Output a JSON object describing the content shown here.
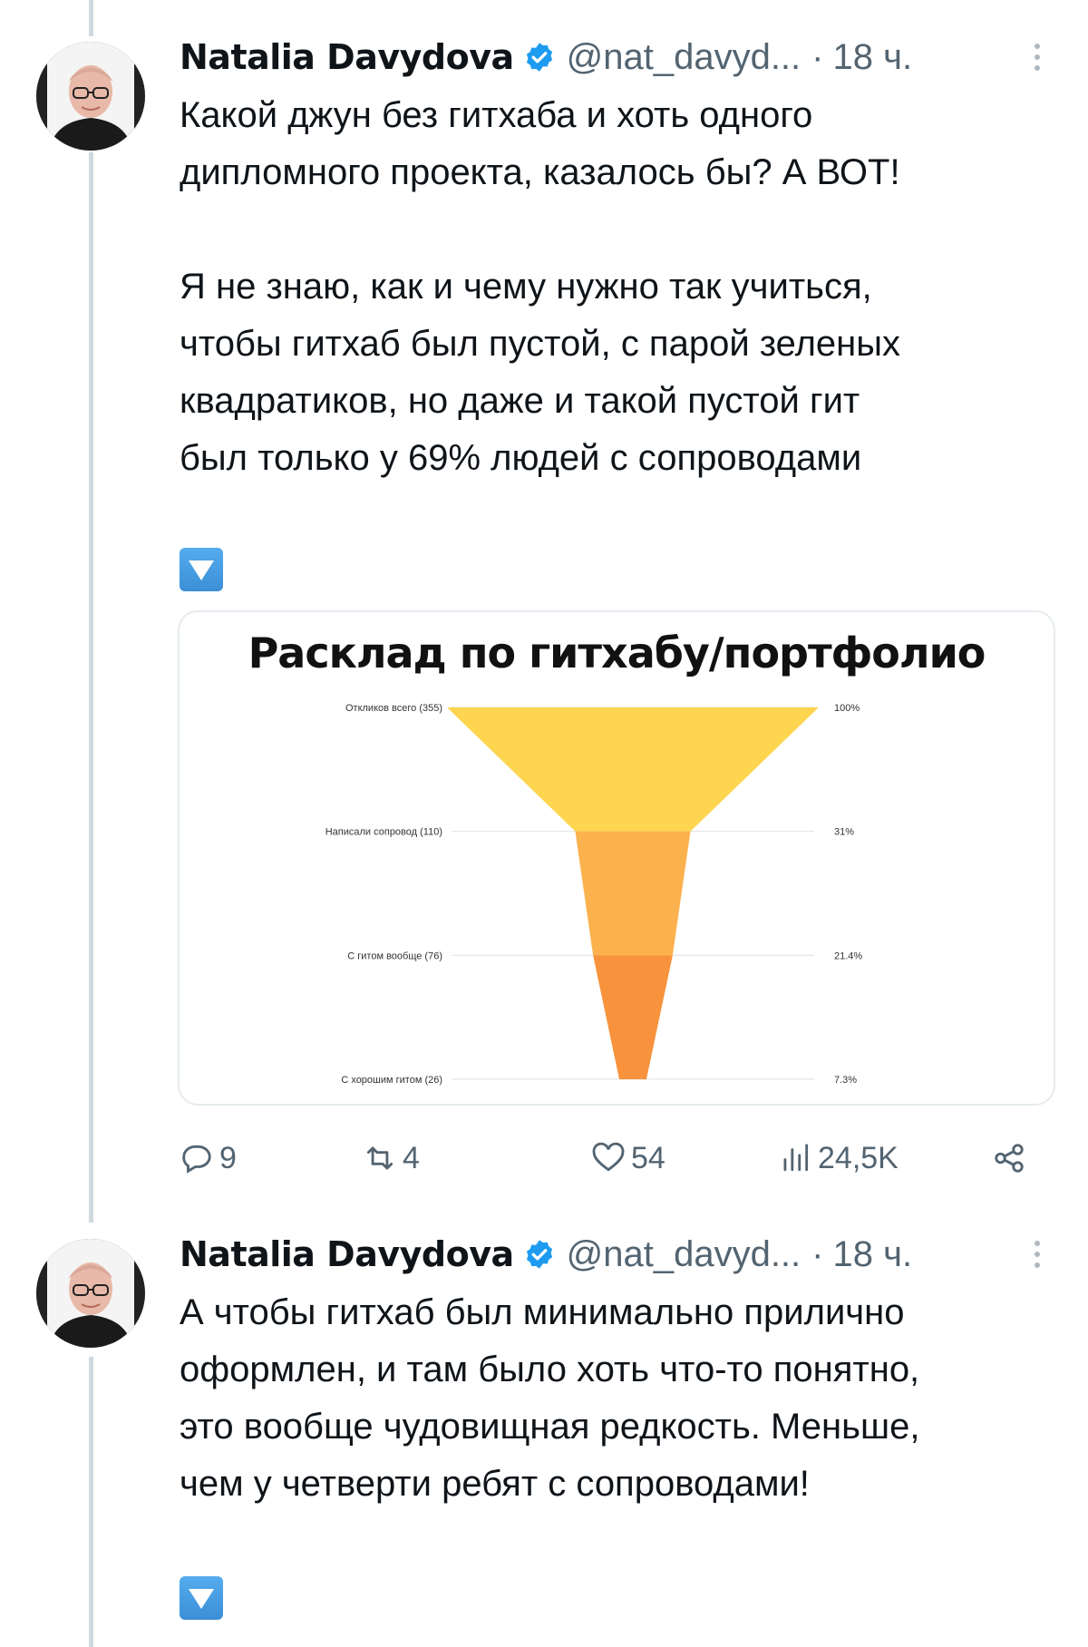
{
  "tweets": [
    {
      "author_name": "Natalia Davydova",
      "handle": "@nat_davyd...",
      "separator": "·",
      "time": "18 ч.",
      "text": "Какой джун без гитхаба и хоть одного\nдипломного проекта, казалось бы? А ВОТ!\n\nЯ не знаю, как и чему нужно так учиться,\nчтобы гитхаб был пустой, с парой зеленых\nквадратиков, но даже и такой пустой гит\nбыл только у 69% людей с сопроводами",
      "emoji": "down-arrow-button-icon",
      "actions": {
        "replies": "9",
        "reposts": "4",
        "likes": "54",
        "views": "24,5K"
      }
    },
    {
      "author_name": "Natalia Davydova",
      "handle": "@nat_davyd...",
      "separator": "·",
      "time": "18 ч.",
      "text": "А чтобы гитхаб был минимально прилично\nоформлен, и там было хоть что-то понятно,\nэто вообще чудовищная редкость. Меньше,\nчем у четверти ребят с сопроводами!",
      "emoji": "down-arrow-button-icon"
    }
  ],
  "colors": {
    "verified": "#1d9bf0",
    "muted": "#536471",
    "thread_line": "#cfd9de",
    "funnel": [
      "#fdd54f",
      "#fbb24d",
      "#f8923c"
    ]
  },
  "chart_data": {
    "type": "funnel",
    "title": "Расклад по гитхабу/портфолио",
    "stages": [
      {
        "label": "Откликов всего (355)",
        "count": 355,
        "percent_label": "100%",
        "percent": 100
      },
      {
        "label": "Написали сопровод (110)",
        "count": 110,
        "percent_label": "31%",
        "percent": 31
      },
      {
        "label": "С гитом вообще (76)",
        "count": 76,
        "percent_label": "21.4%",
        "percent": 21.4
      },
      {
        "label": "С хорошим гитом (26)",
        "count": 26,
        "percent_label": "7.3%",
        "percent": 7.3
      }
    ]
  }
}
